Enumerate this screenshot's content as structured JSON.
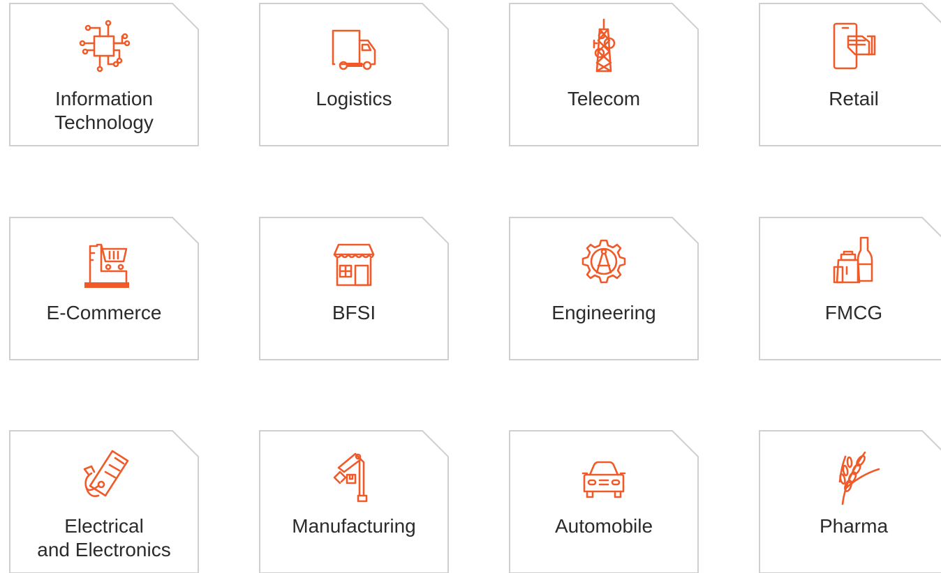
{
  "accent_color": "#f05a28",
  "border_color": "#cfcfcf",
  "text_color": "#2b2b2b",
  "industries": [
    {
      "icon": "circuit-chip-icon",
      "line1": "Information",
      "line2": "Technology"
    },
    {
      "icon": "delivery-truck-icon",
      "line1": "Logistics",
      "line2": ""
    },
    {
      "icon": "cell-tower-icon",
      "line1": "Telecom",
      "line2": ""
    },
    {
      "icon": "mobile-payment-icon",
      "line1": "Retail",
      "line2": ""
    },
    {
      "icon": "laptop-cart-icon",
      "line1": "E-Commerce",
      "line2": ""
    },
    {
      "icon": "storefront-icon",
      "line1": "BFSI",
      "line2": ""
    },
    {
      "icon": "compass-gear-icon",
      "line1": "Engineering",
      "line2": ""
    },
    {
      "icon": "grocery-bottle-icon",
      "line1": "FMCG",
      "line2": ""
    },
    {
      "icon": "plug-cable-icon",
      "line1": "Electrical",
      "line2": "and Electronics"
    },
    {
      "icon": "robotic-arm-icon",
      "line1": "Manufacturing",
      "line2": ""
    },
    {
      "icon": "car-front-icon",
      "line1": "Automobile",
      "line2": ""
    },
    {
      "icon": "wheat-icon",
      "line1": "Pharma",
      "line2": ""
    }
  ]
}
